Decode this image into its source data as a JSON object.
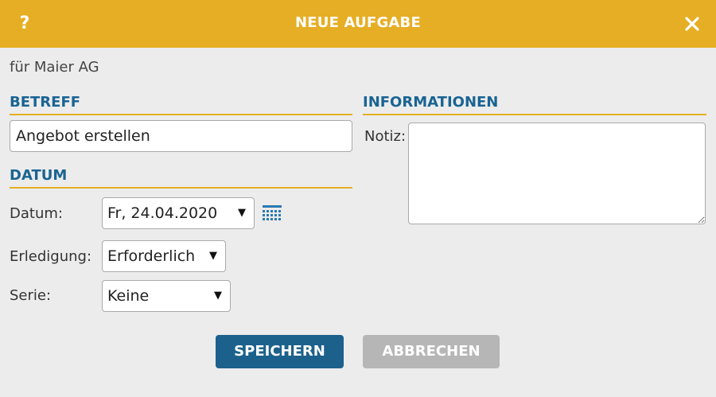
{
  "dialog": {
    "title": "NEUE AUFGABE",
    "help_label": "?",
    "close_icon": "close-icon"
  },
  "customer_line": "für Maier AG",
  "betreff": {
    "heading": "BETREFF",
    "value": "Angebot erstellen"
  },
  "datum": {
    "heading": "DATUM",
    "date_label": "Datum:",
    "date_value": "Fr, 24.04.2020",
    "completion_label": "Erledigung:",
    "completion_value": "Erforderlich",
    "series_label": "Serie:",
    "series_value": "Keine",
    "calendar_icon": "calendar-icon"
  },
  "informationen": {
    "heading": "INFORMATIONEN",
    "note_label": "Notiz:",
    "note_value": ""
  },
  "buttons": {
    "save": "SPEICHERN",
    "cancel": "ABBRECHEN"
  },
  "colors": {
    "titlebar": "#e6ae24",
    "heading": "#1a6493",
    "save_button": "#1c618c",
    "cancel_button": "#b6b6b6",
    "background": "#ececec"
  }
}
